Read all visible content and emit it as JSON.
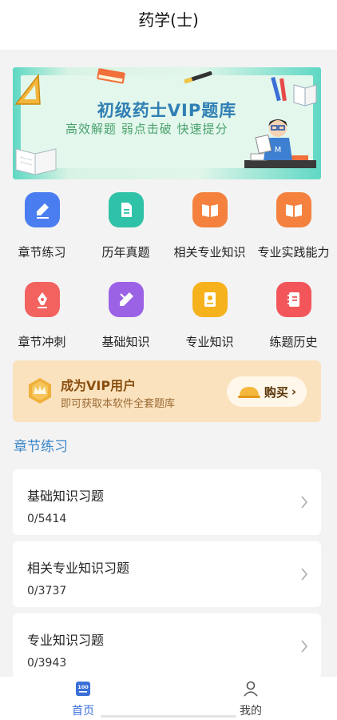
{
  "header": {
    "title": "药学(士)"
  },
  "banner": {
    "title": "初级药士VIP题库",
    "subtitle": "高效解题 弱点击破 快速提分"
  },
  "grid": [
    {
      "label": "章节练习",
      "icon": "pencil-note-icon",
      "color": "#4a7df0"
    },
    {
      "label": "历年真题",
      "icon": "document-icon",
      "color": "#2fc2a8"
    },
    {
      "label": "相关专业知识",
      "icon": "open-book-icon",
      "color": "#f4823e"
    },
    {
      "label": "专业实践能力",
      "icon": "open-book-icon",
      "color": "#f4823e"
    },
    {
      "label": "章节冲刺",
      "icon": "pen-nib-icon",
      "color": "#f2625f"
    },
    {
      "label": "基础知识",
      "icon": "pencil-icon",
      "color": "#9b62e6"
    },
    {
      "label": "专业知识",
      "icon": "certificate-icon",
      "color": "#f6b21d"
    },
    {
      "label": "练题历史",
      "icon": "notebook-icon",
      "color": "#f2565a"
    }
  ],
  "vip": {
    "title": "成为VIP用户",
    "subtitle": "即可获取本软件全套题库",
    "buy_label": "购买",
    "buy_arrow": "›"
  },
  "section": {
    "title": "章节练习"
  },
  "cards": [
    {
      "title": "基础知识习题",
      "count": "0/5414"
    },
    {
      "title": "相关专业知识习题",
      "count": "0/3737"
    },
    {
      "title": "专业知识习题",
      "count": "0/3943"
    }
  ],
  "tabs": [
    {
      "label": "首页",
      "icon": "home-100-icon",
      "active": true
    },
    {
      "label": "我的",
      "icon": "user-icon",
      "active": false
    }
  ],
  "colors": {
    "accent": "#3a86c8",
    "vip_bg": "#fbe2be",
    "vip_text": "#8a4f10"
  }
}
